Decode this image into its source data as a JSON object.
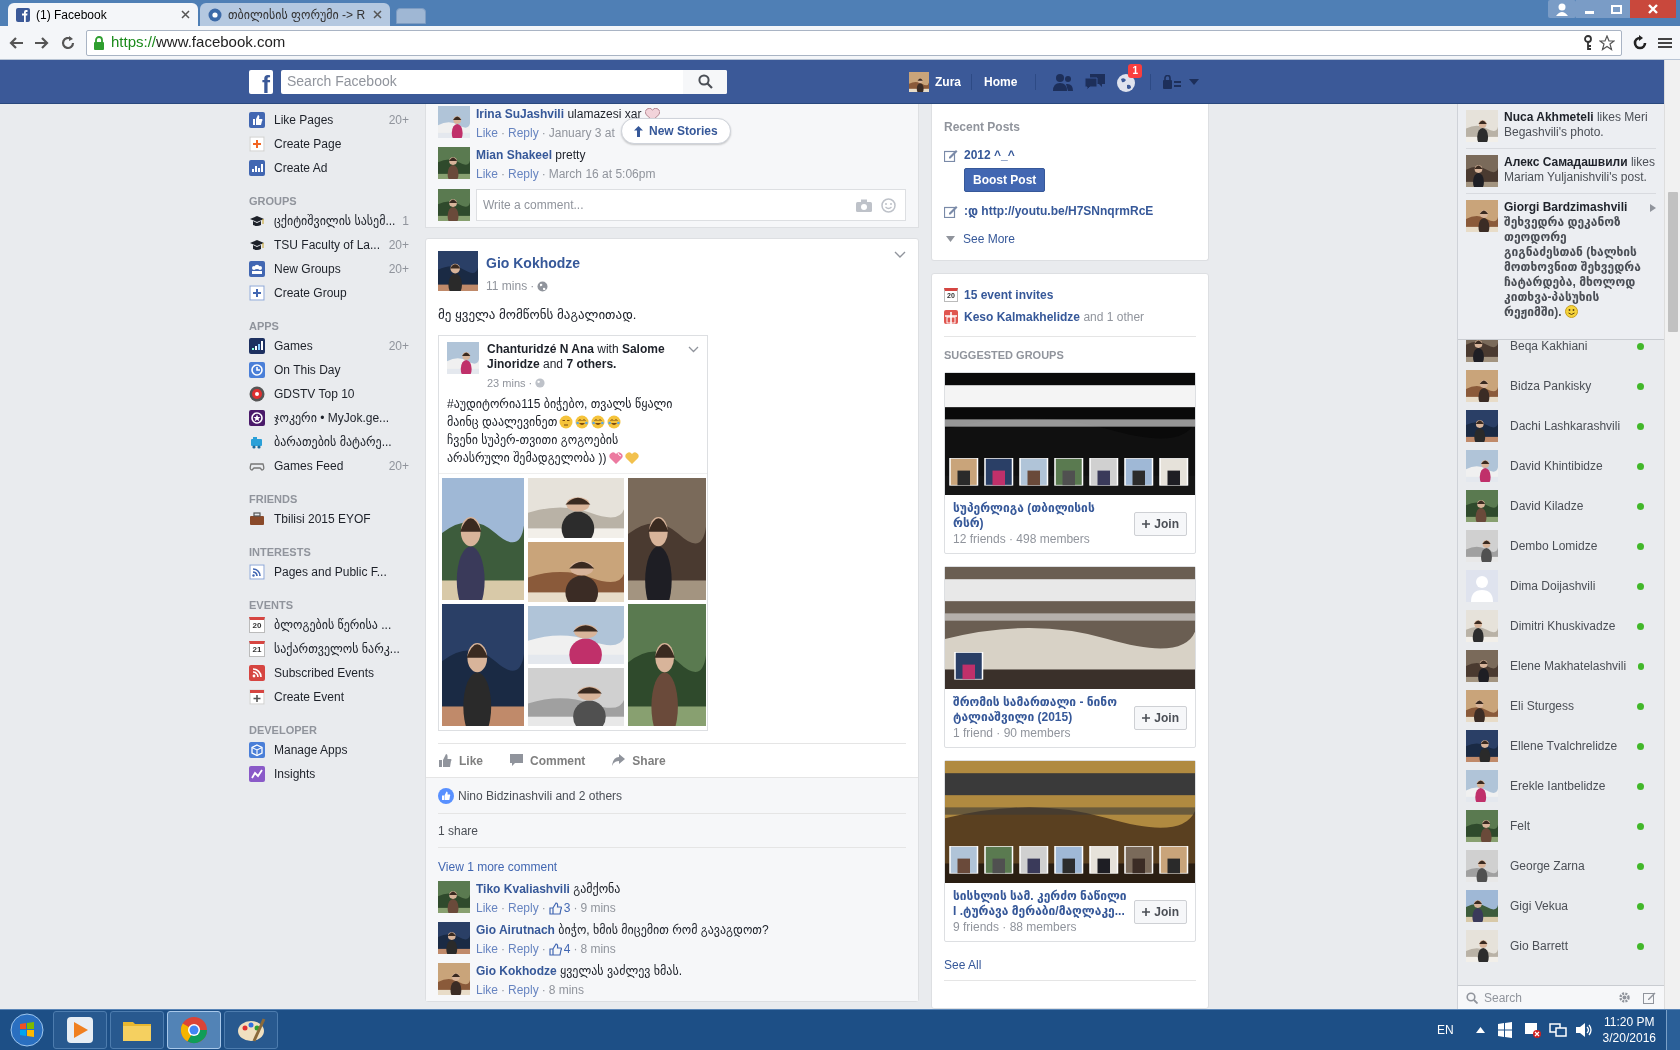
{
  "separator": "·",
  "browser": {
    "tabs": [
      {
        "title": "(1) Facebook",
        "selected": true
      },
      {
        "title": "თბილისის ფორუმი -> R",
        "selected": false
      }
    ],
    "url": {
      "scheme": "https://",
      "host": "www.facebook.com"
    }
  },
  "fb_bar": {
    "logo": "f",
    "search_placeholder": "Search Facebook",
    "user": "Zura",
    "home": "Home",
    "notification_count": "1"
  },
  "sidebar": {
    "sections": [
      {
        "items": [
          {
            "label": "Like Pages",
            "count": "20+"
          },
          {
            "label": "Create Page"
          },
          {
            "label": "Create Ad"
          }
        ]
      },
      {
        "heading": "GROUPS",
        "items": [
          {
            "label": "ცქიტიშვილის სასემ...",
            "count": "1"
          },
          {
            "label": "TSU Faculty of La...",
            "count": "20+"
          },
          {
            "label": "New Groups",
            "count": "20+"
          },
          {
            "label": "Create Group"
          }
        ]
      },
      {
        "heading": "APPS",
        "items": [
          {
            "label": "Games",
            "count": "20+"
          },
          {
            "label": "On This Day"
          },
          {
            "label": "GDSTV Top 10"
          },
          {
            "label": "ჯოკერი • MyJok.ge..."
          },
          {
            "label": "ბარათების მატარე..."
          },
          {
            "label": "Games Feed",
            "count": "20+"
          }
        ]
      },
      {
        "heading": "FRIENDS",
        "items": [
          {
            "label": "Tbilisi 2015 EYOF"
          }
        ]
      },
      {
        "heading": "INTERESTS",
        "items": [
          {
            "label": "Pages and Public F..."
          }
        ]
      },
      {
        "heading": "EVENTS",
        "items": [
          {
            "label": "ბლოგების წერისა ...",
            "date": "20"
          },
          {
            "label": "საქართველოს ნარკ...",
            "date": "21"
          },
          {
            "label": "Subscribed Events"
          },
          {
            "label": "Create Event"
          }
        ]
      },
      {
        "heading": "DEVELOPER",
        "items": [
          {
            "label": "Manage Apps"
          },
          {
            "label": "Insights"
          }
        ]
      }
    ]
  },
  "previous_post": {
    "comments": [
      {
        "author": "Irina SuJashvili",
        "text": "ulamazesi xar",
        "kind": "heart",
        "actions": [
          "Like",
          "Reply"
        ],
        "time": "January 3 at"
      },
      {
        "author": "Mian Shakeel",
        "text": "pretty",
        "kind": "plain",
        "actions": [
          "Like",
          "Reply"
        ],
        "time": "March 16 at 5:06pm"
      }
    ],
    "comment_placeholder": "Write a comment..."
  },
  "new_stories": "New Stories",
  "post": {
    "author": "Gio Kokhodze",
    "time": "11 mins",
    "text": "მე ყველა მომწონს მაგალითად.",
    "shared": {
      "header": "**Chanturidzé N Ana** with **Salome Jinoridze** and **7 others.**",
      "time": "23 mins",
      "lines": [
        {
          "text": "#აუდიტორია115 ბიჭებო, თვალს წყალი"
        },
        {
          "text": "მაინც დაალევინეთ",
          "emojis": [
            {
              "kind": "unamused"
            },
            {
              "kind": "joy"
            },
            {
              "kind": "joy"
            },
            {
              "kind": "joy"
            }
          ]
        },
        {
          "text": "ჩვენი სუპერ-თვითი გოგოების"
        },
        {
          "text": "არასრული შემადგელობა ))",
          "emojis": [
            {
              "kind": "pink-heart"
            },
            {
              "kind": "yellow-heart"
            }
          ]
        }
      ]
    },
    "actions": [
      "Like",
      "Comment",
      "Share"
    ],
    "likes": "Nino Bidzinashvili and 2 others",
    "shares": "1 share",
    "view_more": "View 1 more comment",
    "comments": [
      {
        "author": "Tiko Kvaliashvili",
        "text": "გამქონა",
        "actions": [
          "Like",
          "Reply"
        ],
        "likes": "3",
        "time": "9 mins"
      },
      {
        "author": "Gio Airutnach",
        "text": "ბიჭო, ხმის მიცემით რომ გავაგდოთ?",
        "actions": [
          "Like",
          "Reply"
        ],
        "likes": "4",
        "time": "8 mins"
      },
      {
        "author": "Gio Kokhodze",
        "text": "ყველას ვაძლევ ხმას.",
        "actions": [
          "Like",
          "Reply"
        ],
        "time": "8 mins"
      }
    ]
  },
  "recent_posts": {
    "heading": "Recent Posts",
    "posts": [
      {
        "title": "2012 ^_^",
        "button": "Boost Post"
      },
      {
        "title": ":დ http://youtu.be/H7SNnqrmRcE"
      }
    ],
    "see_more": "See More"
  },
  "events": {
    "invites": "15 event invites",
    "invites_date": "20",
    "birthday": "**Keso Kalmakhelidze** and 1 other"
  },
  "suggested_groups": {
    "heading": "SUGGESTED GROUPS",
    "groups": [
      {
        "name": "სუპერლიგა (თბილისის რსრ)",
        "stats": "12 friends · 498 members",
        "join": "Join"
      },
      {
        "name": "შრომის სამართალი - ნინო ტალიაშვილი (2015)",
        "stats": "1 friend · 90 members",
        "join": "Join"
      },
      {
        "name": "სისხლის სამ. კერძო ნაწილი I .ტურავა მერაბი/მაღლაკე...",
        "stats": "9 friends · 88 members",
        "join": "Join"
      }
    ],
    "see_all": "See All"
  },
  "ticker": [
    {
      "author": "Nuca Akhmeteli",
      "text": "likes Meri Begashvili's photo.",
      "kind": "like"
    },
    {
      "author": "Алекс Самадашвили",
      "text": "likes Mariam Yuljanishvili's post.",
      "kind": "like"
    },
    {
      "author": "Giorgi Bardzimashvili",
      "text": "შეხვედრა დეკანოზ თეოდორე გიგნაძესთან (ხალხის მოთხოვნით შეხვედრა ჩატარდება, მხოლოდ კითხვა-პასუხის რეჟიმში).",
      "kind": "post"
    }
  ],
  "contacts": [
    {
      "name": "Beqa Kakhiani",
      "online": true
    },
    {
      "name": "Bidza Pankisky",
      "online": true
    },
    {
      "name": "Dachi Lashkarashvili",
      "online": true
    },
    {
      "name": "David Khintibidze",
      "online": true
    },
    {
      "name": "David Kiladze",
      "online": true
    },
    {
      "name": "Dembo Lomidze",
      "online": true
    },
    {
      "name": "Dima Doijashvili",
      "online": true,
      "kind": "placeholder"
    },
    {
      "name": "Dimitri Khuskivadze",
      "online": true
    },
    {
      "name": "Elene Makhatelashvili",
      "online": true
    },
    {
      "name": "Eli Sturgess",
      "online": true
    },
    {
      "name": "Ellene Tvalchrelidze",
      "online": true
    },
    {
      "name": "Erekle Iantbelidze",
      "online": true
    },
    {
      "name": "Felt",
      "online": true
    },
    {
      "name": "George Zarna",
      "online": true
    },
    {
      "name": "Gigi Vekua",
      "online": true
    },
    {
      "name": "Gio Barrett",
      "online": true
    }
  ],
  "chat_search_placeholder": "Search",
  "taskbar": {
    "language": "EN",
    "time": "11:20 PM",
    "date": "3/20/2016"
  }
}
